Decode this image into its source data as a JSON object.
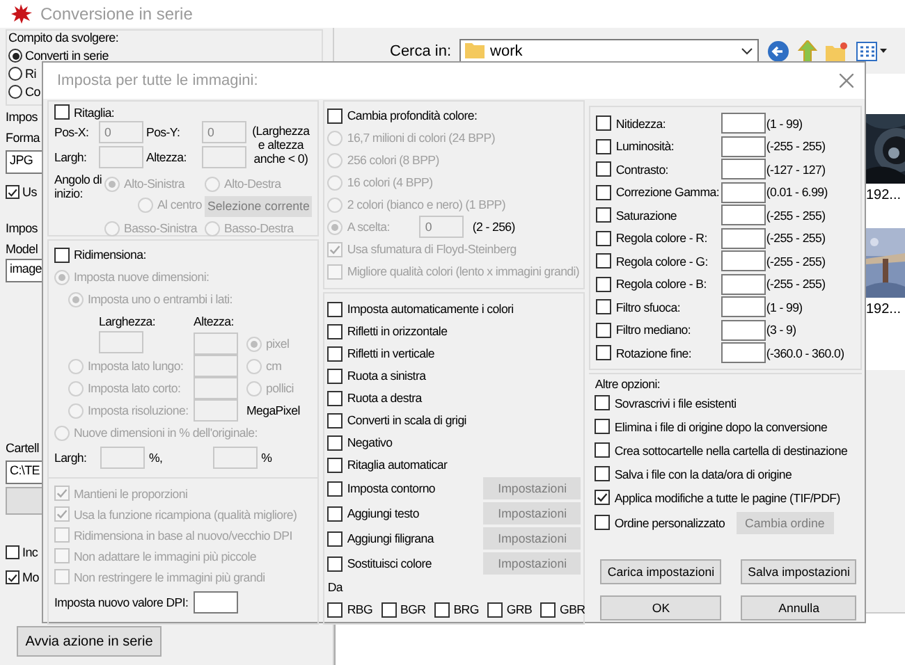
{
  "window": {
    "title": "Conversione in serie"
  },
  "main": {
    "task_group": "Compito da svolgere:",
    "tasks": [
      {
        "label": "Converti in serie",
        "selected": true
      },
      {
        "label": "Ri",
        "selected": false
      },
      {
        "label": "Co",
        "selected": false
      }
    ],
    "left_items": [
      {
        "kind": "label",
        "label": "Impos"
      },
      {
        "kind": "label",
        "label": "Forma"
      },
      {
        "kind": "dropdown",
        "value": "JPG"
      },
      {
        "kind": "checkbox",
        "label": "Us",
        "checked": true
      },
      {
        "kind": "label",
        "label": "Impos"
      },
      {
        "kind": "label",
        "label": "Model"
      },
      {
        "kind": "field",
        "value": "image"
      },
      {
        "kind": "label",
        "label": "Cartell"
      },
      {
        "kind": "field",
        "value": "C:\\TE"
      },
      {
        "kind": "button"
      },
      {
        "kind": "checkbox",
        "label": "Inc",
        "checked": false
      },
      {
        "kind": "checkbox",
        "label": "Mo",
        "checked": true
      }
    ],
    "run_button": "Avvia azione in serie",
    "look_in": {
      "label": "Cerca in:",
      "value": "work"
    },
    "thumbnails": [
      {
        "kind": "picture",
        "caption": "192..."
      },
      {
        "kind": "picture",
        "caption": "192..."
      }
    ]
  },
  "dialog": {
    "title": "Imposta per tutte le immagini:",
    "crop": {
      "checkbox": {
        "label": "Ritaglia:",
        "checked": false
      },
      "pos_x": {
        "label": "Pos-X:",
        "field": {
          "value": "0",
          "disabled": true
        }
      },
      "pos_y": {
        "label": "Pos-Y:",
        "field": {
          "value": "0",
          "disabled": true
        }
      },
      "note": "(Larghezza e altezza anche < 0)",
      "width": {
        "label": "Largh:",
        "field": {
          "disabled": true
        }
      },
      "height": {
        "label": "Altezza:",
        "field": {
          "disabled": true
        }
      },
      "corner_label": "Angolo di inizio:",
      "corners": [
        {
          "label": "Alto-Sinistra",
          "selected": true,
          "disabled": true
        },
        {
          "label": "Alto-Destra",
          "selected": false,
          "disabled": true
        },
        {
          "label": "Al centro",
          "selected": false,
          "disabled": true
        },
        {
          "label": "Basso-Sinistra",
          "selected": false,
          "disabled": true
        },
        {
          "label": "Basso-Destra",
          "selected": false,
          "disabled": true
        }
      ],
      "current_selection": {
        "label": "Selezione corrente",
        "disabled": true
      }
    },
    "resize": {
      "checkbox": {
        "label": "Ridimensiona:",
        "checked": false
      },
      "new_size": {
        "label": "Imposta nuove dimensioni:",
        "selected": true,
        "disabled": true
      },
      "both_sides": {
        "label": "Imposta uno o entrambi i lati:",
        "selected": true,
        "disabled": true
      },
      "width_label": "Larghezza:",
      "height_label": "Altezza:",
      "width_field": {
        "disabled": true
      },
      "height_field": {
        "disabled": true
      },
      "units": [
        {
          "label": "pixel",
          "selected": true,
          "disabled": true
        },
        {
          "label": "cm",
          "selected": false,
          "disabled": true
        },
        {
          "label": "pollici",
          "selected": false,
          "disabled": true
        }
      ],
      "long_side": {
        "label": "Imposta lato lungo:",
        "selected": false,
        "disabled": true,
        "field": {
          "disabled": true
        }
      },
      "short_side": {
        "label": "Imposta lato corto:",
        "selected": false,
        "disabled": true,
        "field": {
          "disabled": true
        }
      },
      "resolution": {
        "label": "Imposta risoluzione:",
        "selected": false,
        "disabled": true,
        "field": {
          "disabled": true
        },
        "unit": "MegaPixel"
      },
      "percent": {
        "label": "Nuove dimensioni in % dell'originale:",
        "selected": false,
        "disabled": true
      },
      "percent_width": {
        "label": "Largh:",
        "field": {
          "disabled": true
        },
        "unit": "%,"
      },
      "percent_height": {
        "field": {
          "disabled": true
        },
        "unit": "%"
      },
      "options": [
        {
          "label": "Mantieni le proporzioni",
          "checked": true,
          "disabled": true
        },
        {
          "label": "Usa la funzione ricampiona (qualità migliore)",
          "checked": true,
          "disabled": true
        },
        {
          "label": "Ridimensiona in base al nuovo/vecchio DPI",
          "checked": false,
          "disabled": true
        },
        {
          "label": "Non adattare le immagini più piccole",
          "checked": false,
          "disabled": true
        },
        {
          "label": "Non restringere le immagini più grandi",
          "checked": false,
          "disabled": true
        }
      ],
      "dpi": {
        "label": "Imposta nuovo valore DPI:",
        "field": {
          "disabled": false
        }
      }
    },
    "color_depth": {
      "checkbox": {
        "label": "Cambia profondità colore:",
        "checked": false
      },
      "depths": [
        {
          "label": "16,7 milioni di colori (24 BPP)",
          "selected": false,
          "disabled": true
        },
        {
          "label": "256 colori (8 BPP)",
          "selected": false,
          "disabled": true
        },
        {
          "label": "16 colori (4 BPP)",
          "selected": false,
          "disabled": true
        },
        {
          "label": "2 colori (bianco e nero) (1 BPP)",
          "selected": false,
          "disabled": true
        },
        {
          "label": "A scelta:",
          "selected": true,
          "disabled": true
        }
      ],
      "custom_field": {
        "value": "0",
        "disabled": true
      },
      "custom_range": "(2 - 256)",
      "options": [
        {
          "label": "Usa sfumatura di Floyd-Steinberg",
          "checked": true,
          "disabled": true
        },
        {
          "label": "Migliore qualità colori (lento x immagini grandi)",
          "checked": false,
          "disabled": true
        }
      ]
    },
    "operations": [
      {
        "kind": "option",
        "label": "Imposta automaticamente i colori",
        "checked": false
      },
      {
        "kind": "option",
        "label": "Rifletti in orizzontale",
        "checked": false
      },
      {
        "kind": "option",
        "label": "Rifletti in verticale",
        "checked": false
      },
      {
        "kind": "option",
        "label": "Ruota a sinistra",
        "checked": false
      },
      {
        "kind": "option",
        "label": "Ruota a destra",
        "checked": false
      },
      {
        "kind": "option",
        "label": "Converti in scala di grigi",
        "checked": false
      },
      {
        "kind": "option",
        "label": "Negativo",
        "checked": false
      },
      {
        "kind": "option",
        "label": "Ritaglia automaticar",
        "checked": false
      },
      {
        "kind": "option_with_button",
        "label": "Imposta contorno",
        "checked": false,
        "button": {
          "label": "Impostazioni",
          "disabled": true
        }
      },
      {
        "kind": "option_with_button",
        "label": "Aggiungi testo",
        "checked": false,
        "button": {
          "label": "Impostazioni",
          "disabled": true
        }
      },
      {
        "kind": "option_with_button",
        "label": "Aggiungi filigrana",
        "checked": false,
        "button": {
          "label": "Impostazioni",
          "disabled": true
        }
      },
      {
        "kind": "option_with_button",
        "label": "Sostituisci colore",
        "checked": false,
        "button": {
          "label": "Impostazioni",
          "disabled": true
        }
      }
    ],
    "swap_label": "Da",
    "swaps": [
      {
        "label": "RBG",
        "checked": false
      },
      {
        "label": "BGR",
        "checked": false
      },
      {
        "label": "BRG",
        "checked": false
      },
      {
        "label": "GRB",
        "checked": false
      },
      {
        "label": "GBR",
        "checked": false
      }
    ],
    "adjustments": [
      {
        "label": "Nitidezza:",
        "checked": false,
        "range": "(1 - 99)"
      },
      {
        "label": "Luminosità:",
        "checked": false,
        "range": "(-255 - 255)"
      },
      {
        "label": "Contrasto:",
        "checked": false,
        "range": "(-127 - 127)"
      },
      {
        "label": "Correzione Gamma:",
        "checked": false,
        "range": "(0.01 - 6.99)"
      },
      {
        "label": "Saturazione",
        "checked": false,
        "range": "(-255 - 255)"
      },
      {
        "label": "Regola colore - R:",
        "checked": false,
        "range": "(-255 - 255)"
      },
      {
        "label": "Regola colore - G:",
        "checked": false,
        "range": "(-255 - 255)"
      },
      {
        "label": "Regola colore - B:",
        "checked": false,
        "range": "(-255 - 255)"
      },
      {
        "label": "Filtro sfuoca:",
        "checked": false,
        "range": "(1 - 99)"
      },
      {
        "label": "Filtro mediano:",
        "checked": false,
        "range": "(3 - 9)"
      },
      {
        "label": "Rotazione fine:",
        "checked": false,
        "range": "(-360.0 - 360.0)"
      }
    ],
    "other_label": "Altre opzioni:",
    "other_options": [
      {
        "kind": "option",
        "label": "Sovrascrivi i file esistenti",
        "checked": false
      },
      {
        "kind": "option",
        "label": "Elimina i file di origine dopo la conversione",
        "checked": false
      },
      {
        "kind": "option",
        "label": "Crea sottocartelle nella cartella di destinazione",
        "checked": false
      },
      {
        "kind": "option",
        "label": "Salva i file con la data/ora di origine",
        "checked": false
      },
      {
        "kind": "option",
        "label": "Applica modifiche a tutte le pagine (TIF/PDF)",
        "checked": true
      },
      {
        "kind": "option_with_button",
        "label": "Ordine personalizzato",
        "checked": false,
        "button": {
          "label": "Cambia ordine",
          "disabled": true
        }
      }
    ],
    "buttons": [
      {
        "label": "Carica impostazioni"
      },
      {
        "label": "Salva impostazioni"
      },
      {
        "label": "OK"
      },
      {
        "label": "Annulla"
      }
    ]
  }
}
